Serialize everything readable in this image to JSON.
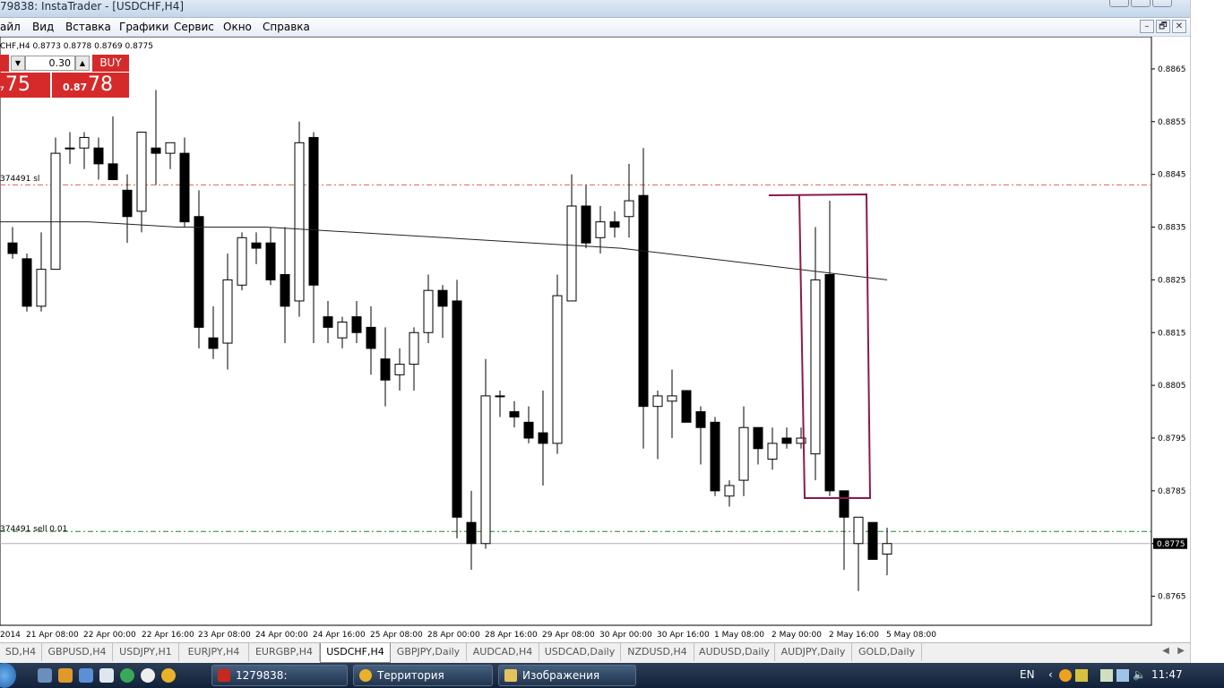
{
  "window": {
    "title": "79838: InstaTrader - [USDCHF,H4]"
  },
  "menu": [
    "айл",
    "Вид",
    "Вставка",
    "Графики",
    "Сервис",
    "Окно",
    "Справка"
  ],
  "mdi_buttons": [
    "–",
    "🗗",
    "✕"
  ],
  "chart_header": "CHF,H4  0.8773 0.8778 0.8769 0.8775",
  "one_click": {
    "lot": "0.30",
    "buy_label": "BUY",
    "sell_price_big": "75",
    "sell_price_small": "₇",
    "buy_price_small": "0.87",
    "buy_price_big": "78"
  },
  "line_labels": {
    "sl": "374491 sl",
    "sell": "374491 sell 0.01"
  },
  "chart_data": {
    "type": "candlestick",
    "symbol": "USDCHF",
    "timeframe": "H4",
    "ylim": [
      0.87595,
      0.88711
    ],
    "y_ticks": [
      "0.8865",
      "0.8855",
      "0.8845",
      "0.8835",
      "0.8825",
      "0.8815",
      "0.8805",
      "0.8795",
      "0.8785",
      "0.8775",
      "0.8765"
    ],
    "current_price": "0.8775",
    "x_ticks": [
      "2014",
      "21 Apr 08:00",
      "22 Apr 00:00",
      "22 Apr 16:00",
      "23 Apr 08:00",
      "24 Apr 00:00",
      "24 Apr 16:00",
      "25 Apr 08:00",
      "28 Apr 00:00",
      "28 Apr 16:00",
      "29 Apr 08:00",
      "30 Apr 00:00",
      "30 Apr 16:00",
      "1 May 08:00",
      "2 May 00:00",
      "2 May 16:00",
      "5 May 08:00"
    ],
    "candles": [
      [
        0.8832,
        0.8835,
        0.8829,
        0.883
      ],
      [
        0.8829,
        0.883,
        0.8819,
        0.882
      ],
      [
        0.882,
        0.8834,
        0.8819,
        0.8827
      ],
      [
        0.8827,
        0.8852,
        0.8827,
        0.8849
      ],
      [
        0.885,
        0.8853,
        0.8847,
        0.885
      ],
      [
        0.885,
        0.8853,
        0.8846,
        0.8852
      ],
      [
        0.885,
        0.8852,
        0.8844,
        0.8847
      ],
      [
        0.8847,
        0.8856,
        0.8844,
        0.8844
      ],
      [
        0.8842,
        0.8845,
        0.8832,
        0.8837
      ],
      [
        0.8838,
        0.8853,
        0.8834,
        0.8853
      ],
      [
        0.885,
        0.8861,
        0.8843,
        0.8849
      ],
      [
        0.8849,
        0.8851,
        0.8846,
        0.8851
      ],
      [
        0.8849,
        0.8852,
        0.8835,
        0.8836
      ],
      [
        0.8837,
        0.8842,
        0.8812,
        0.8816
      ],
      [
        0.8814,
        0.882,
        0.881,
        0.8812
      ],
      [
        0.8813,
        0.883,
        0.8808,
        0.8825
      ],
      [
        0.8824,
        0.8834,
        0.8823,
        0.8833
      ],
      [
        0.8832,
        0.8834,
        0.8828,
        0.8831
      ],
      [
        0.8832,
        0.8835,
        0.8824,
        0.8825
      ],
      [
        0.8826,
        0.8835,
        0.8813,
        0.882
      ],
      [
        0.8821,
        0.8855,
        0.8818,
        0.8851
      ],
      [
        0.8852,
        0.8853,
        0.8813,
        0.8824
      ],
      [
        0.8818,
        0.8821,
        0.8813,
        0.8816
      ],
      [
        0.8814,
        0.8818,
        0.8812,
        0.8817
      ],
      [
        0.8818,
        0.8821,
        0.8813,
        0.8815
      ],
      [
        0.8816,
        0.882,
        0.8807,
        0.8812
      ],
      [
        0.881,
        0.8816,
        0.8801,
        0.8806
      ],
      [
        0.8807,
        0.8812,
        0.8804,
        0.8809
      ],
      [
        0.8809,
        0.8816,
        0.8804,
        0.8815
      ],
      [
        0.8815,
        0.8826,
        0.8813,
        0.8823
      ],
      [
        0.8823,
        0.8824,
        0.8814,
        0.882
      ],
      [
        0.8821,
        0.8825,
        0.8776,
        0.878
      ],
      [
        0.8779,
        0.8785,
        0.877,
        0.8775
      ],
      [
        0.8775,
        0.881,
        0.8774,
        0.8803
      ],
      [
        0.8803,
        0.8804,
        0.8799,
        0.8803
      ],
      [
        0.88,
        0.8802,
        0.8797,
        0.8799
      ],
      [
        0.8798,
        0.8801,
        0.8794,
        0.8795
      ],
      [
        0.8796,
        0.8804,
        0.8786,
        0.8794
      ],
      [
        0.8794,
        0.8826,
        0.8792,
        0.8822
      ],
      [
        0.8821,
        0.8845,
        0.8821,
        0.8839
      ],
      [
        0.8839,
        0.8843,
        0.8831,
        0.8832
      ],
      [
        0.8833,
        0.8839,
        0.883,
        0.8836
      ],
      [
        0.8836,
        0.8838,
        0.8833,
        0.8835
      ],
      [
        0.8837,
        0.8847,
        0.8833,
        0.884
      ],
      [
        0.8841,
        0.885,
        0.8793,
        0.8801
      ],
      [
        0.8801,
        0.8804,
        0.8791,
        0.8803
      ],
      [
        0.8802,
        0.8808,
        0.8795,
        0.8803
      ],
      [
        0.8804,
        0.8804,
        0.8798,
        0.8798
      ],
      [
        0.88,
        0.8801,
        0.879,
        0.8797
      ],
      [
        0.8798,
        0.8799,
        0.8784,
        0.8785
      ],
      [
        0.8784,
        0.8787,
        0.8782,
        0.8786
      ],
      [
        0.8787,
        0.8801,
        0.8784,
        0.8797
      ],
      [
        0.8797,
        0.8797,
        0.879,
        0.8793
      ],
      [
        0.8791,
        0.8797,
        0.8789,
        0.8794
      ],
      [
        0.8795,
        0.8797,
        0.8793,
        0.8794
      ],
      [
        0.8794,
        0.8797,
        0.8793,
        0.8795
      ],
      [
        0.8792,
        0.8835,
        0.8787,
        0.8825
      ],
      [
        0.8826,
        0.884,
        0.8784,
        0.8785
      ],
      [
        0.8785,
        0.8785,
        0.877,
        0.878
      ],
      [
        0.8775,
        0.878,
        0.8766,
        0.878
      ],
      [
        0.8779,
        0.8779,
        0.8772,
        0.8772
      ],
      [
        0.8773,
        0.8778,
        0.8769,
        0.8775
      ]
    ],
    "moving_average": [
      0.8836,
      0.8836,
      0.8835,
      0.8835,
      0.8834,
      0.8833,
      0.8832,
      0.8831,
      0.8829,
      0.8827,
      0.8825
    ],
    "levels": {
      "sl": 0.8843,
      "sell": 0.87773
    }
  }
}
